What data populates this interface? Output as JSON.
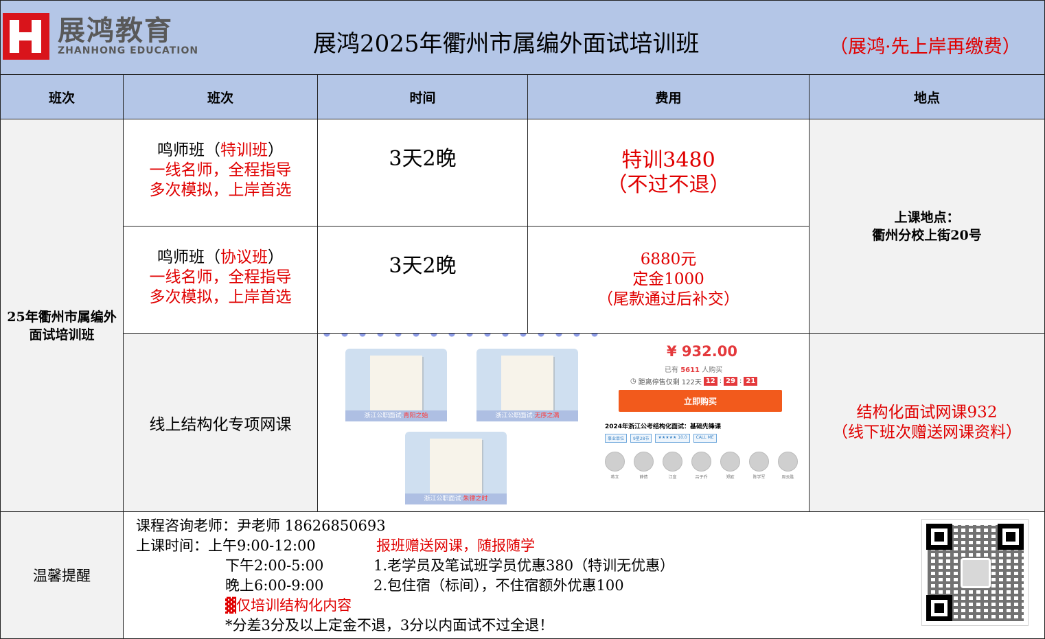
{
  "header": {
    "logo_cn": "展鸿教育",
    "logo_en": "ZHANHONG EDUCATION",
    "title": "展鸿2025年衢州市属编外面试培训班",
    "slogan": "（展鸿·先上岸再缴费）"
  },
  "columns": [
    "班次",
    "班次",
    "时间",
    "费用",
    "地点"
  ],
  "left_label": "25年衢州市属编外面试培训班",
  "rows": [
    {
      "name_prefix": "鸣师班（",
      "name_highlight": "特训班",
      "name_suffix": "）",
      "line2": "一线名师，全程指导",
      "line3": "多次模拟，上岸首选",
      "time": "3天2晚",
      "fee_line1": "特训3480",
      "fee_line2": "（不过不退）"
    },
    {
      "name_prefix": "鸣师班（",
      "name_highlight": "协议班",
      "name_suffix": "）",
      "line2": "一线名师，全程指导",
      "line3": "多次模拟，上岸首选",
      "time": "3天2晚",
      "fee_line1": "6880元",
      "fee_line2": "定金1000",
      "fee_line3": "（尾款通过后补交）"
    }
  ],
  "location": {
    "label": "上课地点：",
    "address": "衢州分校上街20号"
  },
  "online": {
    "name": "线上结构化专项网课",
    "price_line1": "结构化面试网课932",
    "price_line2": "（线下班次赠送网课资料）",
    "promo": {
      "price": "¥ 932.00",
      "sold_prefix": "已有",
      "sold_count": "5611",
      "sold_suffix": "人购买",
      "countdown_label": "距离停售仅剩",
      "days": "122天",
      "hh": "12",
      "mm": "29",
      "ss": "21",
      "buy_label": "立即购买",
      "course_title": "2024年浙江公考结构化面试：基础先锋课",
      "tags": [
        "事业单位",
        "9星28节",
        "★★★★★ 10.0",
        "CALL ME"
      ],
      "books": [
        {
          "caption_prefix": "浙江公职面试·",
          "caption_highlight": "青阳之始"
        },
        {
          "caption_prefix": "浙江公职面试·",
          "caption_highlight": "无序之满"
        },
        {
          "caption_prefix": "浙江公职面试·",
          "caption_highlight": "朱律之时"
        }
      ],
      "teachers": [
        "蒋立",
        "薛倩",
        "江宣",
        "吕子乔",
        "郑欧",
        "陈学军",
        "周云胜"
      ]
    }
  },
  "footer": {
    "label": "温馨提醒",
    "consult": "课程咨询老师：尹老师 18626850693",
    "time_am": "上课时间：上午9:00-12:00",
    "promo_title": "报班赠送网课，随报随学",
    "time_pm": "下午2:00-5:00",
    "benefit1": "1.老学员及笔试班学员优惠380（特训无优惠）",
    "time_eve": "晚上6:00-9:00",
    "benefit2": "2.包住宿（标间），不住宿额外优惠100",
    "only": "▓仅培训结构化内容",
    "refund": "*分差3分及以上定金不退，3分以内面试不过全退！"
  }
}
